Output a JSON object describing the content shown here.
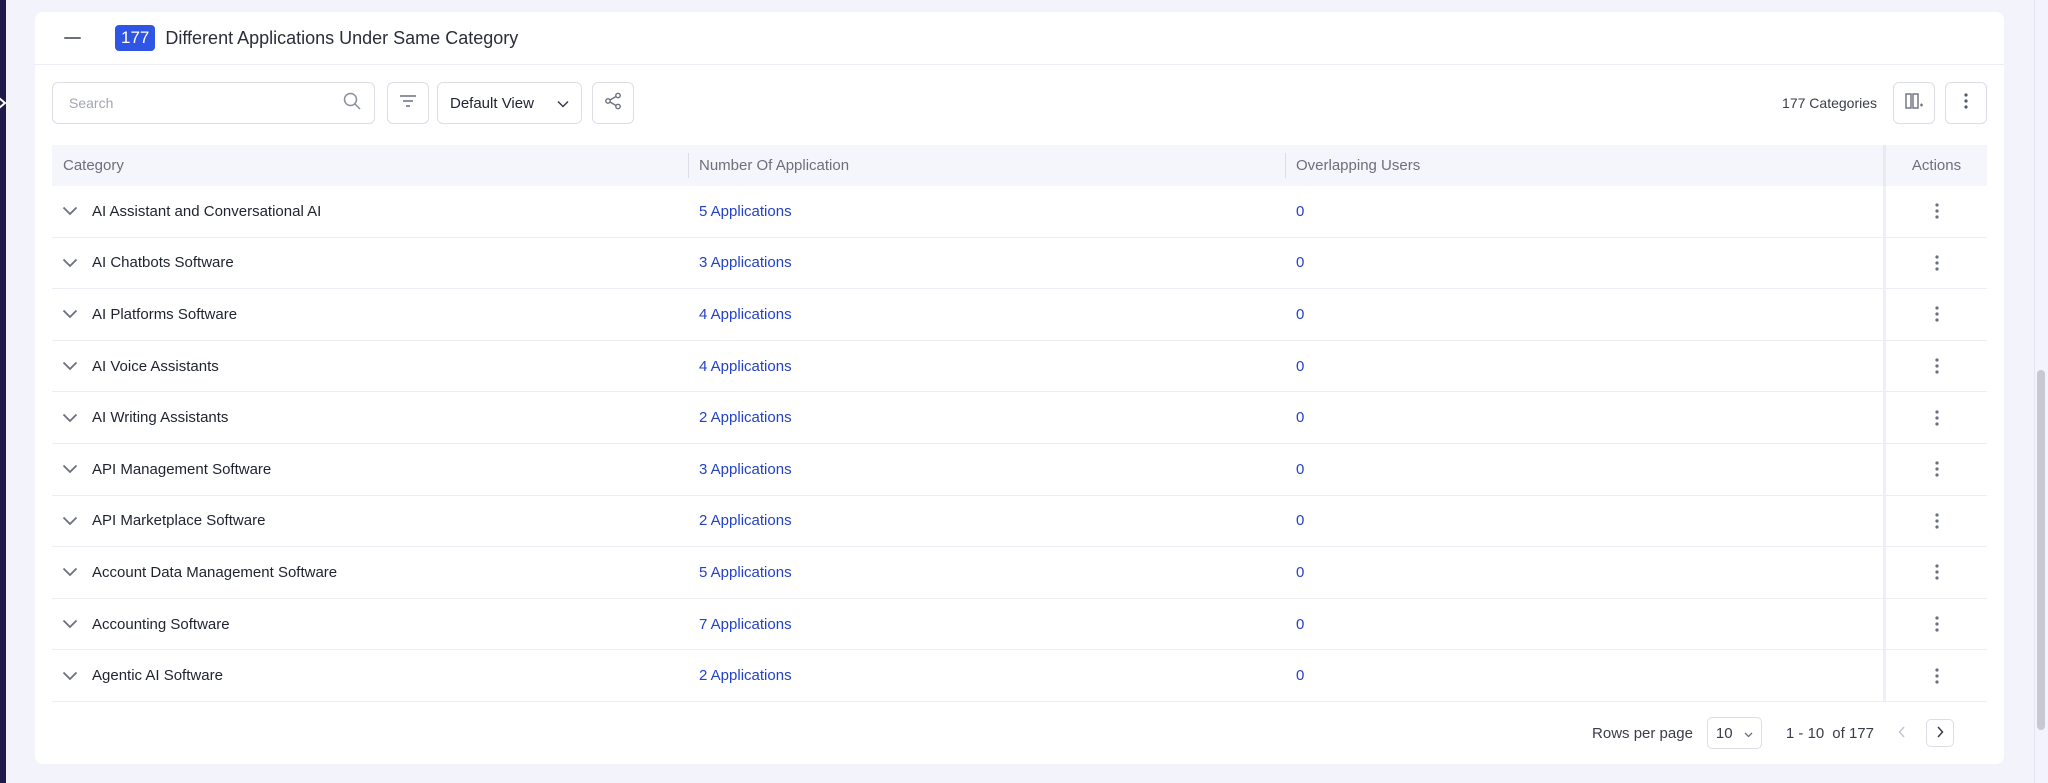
{
  "section": {
    "count_badge": "177",
    "title": "Different Applications Under Same Category"
  },
  "toolbar": {
    "search_placeholder": "Search",
    "view_label": "Default View",
    "categories_count": "177 Categories"
  },
  "table": {
    "headers": {
      "category": "Category",
      "applications": "Number Of Application",
      "users": "Overlapping Users",
      "actions": "Actions"
    },
    "rows": [
      {
        "category": "AI Assistant and Conversational AI",
        "applications": "5 Applications",
        "users": "0"
      },
      {
        "category": "AI Chatbots Software",
        "applications": "3 Applications",
        "users": "0"
      },
      {
        "category": "AI Platforms Software",
        "applications": "4 Applications",
        "users": "0"
      },
      {
        "category": "AI Voice Assistants",
        "applications": "4 Applications",
        "users": "0"
      },
      {
        "category": "AI Writing Assistants",
        "applications": "2 Applications",
        "users": "0"
      },
      {
        "category": "API Management Software",
        "applications": "3 Applications",
        "users": "0"
      },
      {
        "category": "API Marketplace Software",
        "applications": "2 Applications",
        "users": "0"
      },
      {
        "category": "Account Data Management Software",
        "applications": "5 Applications",
        "users": "0"
      },
      {
        "category": "Accounting Software",
        "applications": "7 Applications",
        "users": "0"
      },
      {
        "category": "Agentic AI Software",
        "applications": "2 Applications",
        "users": "0"
      }
    ]
  },
  "pagination": {
    "rows_per_page_label": "Rows per page",
    "rows_per_page_value": "10",
    "range": "1 - 10",
    "of_total": "of 177"
  },
  "colors": {
    "accent": "#2f55e4",
    "link": "#2342c8",
    "rail": "#1e1a4a"
  }
}
